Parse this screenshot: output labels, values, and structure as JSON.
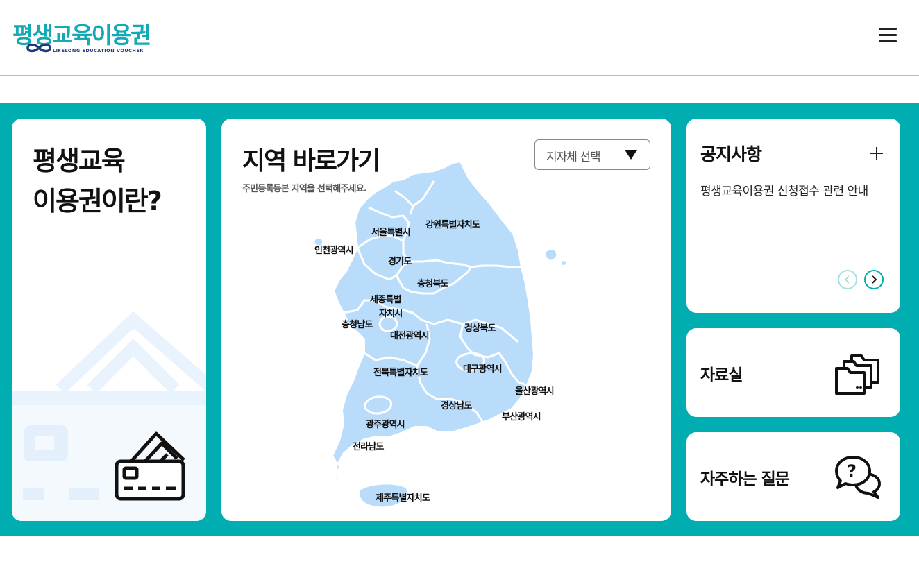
{
  "header": {
    "logo_text": "평생교육이용권",
    "logo_subtext": "LIFELONG EDUCATION VOUCHER",
    "menu_icon": "hamburger-menu-icon"
  },
  "colors": {
    "brand_teal": "#00adb1",
    "map_fill": "#b9dcfb",
    "logo_navy": "#1f3b7a"
  },
  "intro_card": {
    "title": "평생교육\n이용권이란?",
    "icon": "credit-card-icon"
  },
  "map_card": {
    "title": "지역 바로가기",
    "subtitle": "주민등록등본 지역을 선택해주세요.",
    "select_label": "지자체 선택",
    "regions": {
      "seoul": "서울특별시",
      "gangwon": "강원특별자치도",
      "incheon": "인천광역시",
      "gyeonggi": "경기도",
      "chungbuk": "충청북도",
      "sejong_1": "세종특별",
      "sejong_2": "자치시",
      "chungnam": "충청남도",
      "daejeon": "대전광역시",
      "gyeongbuk": "경상북도",
      "daegu": "대구광역시",
      "jeonbuk": "전북특별자치도",
      "ulsan": "울산광역시",
      "gyeongnam": "경상남도",
      "busan": "부산광역시",
      "gwangju": "광주광역시",
      "jeonnam": "전라남도",
      "jeju": "제주특별자치도"
    }
  },
  "notice_card": {
    "title": "공지사항",
    "more_icon": "plus-icon",
    "item": "평생교육이용권 신청접수 관련 안내"
  },
  "archive_card": {
    "title": "자료실",
    "icon": "folders-icon"
  },
  "faq_card": {
    "title": "자주하는 질문",
    "icon": "question-chat-icon"
  }
}
